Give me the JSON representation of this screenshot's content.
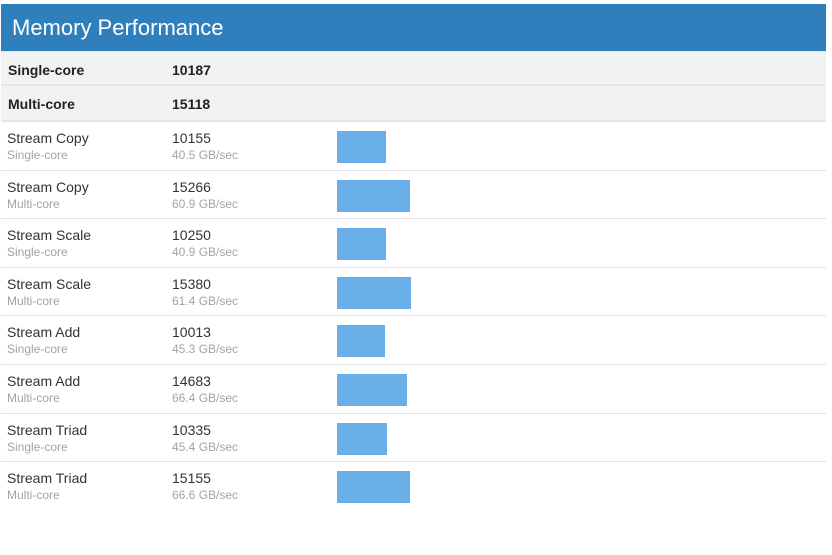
{
  "header": {
    "title": "Memory Performance"
  },
  "summary": [
    {
      "label": "Single-core",
      "score": "10187"
    },
    {
      "label": "Multi-core",
      "score": "15118"
    }
  ],
  "colors": {
    "header_bg": "#2e7fbc",
    "bar": "#6aaee8"
  },
  "scale_max": 100000,
  "rows": [
    {
      "name": "Stream Copy",
      "mode": "Single-core",
      "score": 10155,
      "score_text": "10155",
      "bandwidth": "40.5 GB/sec"
    },
    {
      "name": "Stream Copy",
      "mode": "Multi-core",
      "score": 15266,
      "score_text": "15266",
      "bandwidth": "60.9 GB/sec"
    },
    {
      "name": "Stream Scale",
      "mode": "Single-core",
      "score": 10250,
      "score_text": "10250",
      "bandwidth": "40.9 GB/sec"
    },
    {
      "name": "Stream Scale",
      "mode": "Multi-core",
      "score": 15380,
      "score_text": "15380",
      "bandwidth": "61.4 GB/sec"
    },
    {
      "name": "Stream Add",
      "mode": "Single-core",
      "score": 10013,
      "score_text": "10013",
      "bandwidth": "45.3 GB/sec"
    },
    {
      "name": "Stream Add",
      "mode": "Multi-core",
      "score": 14683,
      "score_text": "14683",
      "bandwidth": "66.4 GB/sec"
    },
    {
      "name": "Stream Triad",
      "mode": "Single-core",
      "score": 10335,
      "score_text": "10335",
      "bandwidth": "45.4 GB/sec"
    },
    {
      "name": "Stream Triad",
      "mode": "Multi-core",
      "score": 15155,
      "score_text": "15155",
      "bandwidth": "66.6 GB/sec"
    }
  ]
}
